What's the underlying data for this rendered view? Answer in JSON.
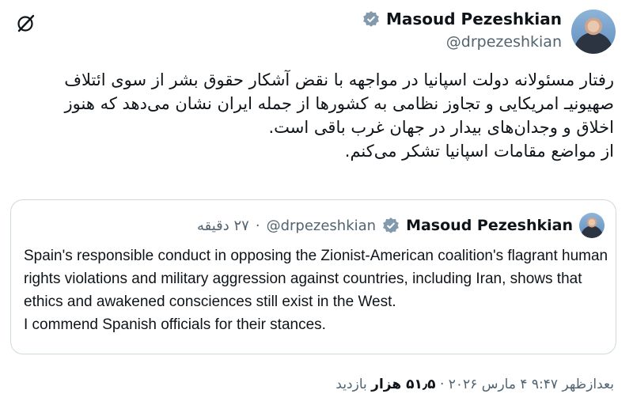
{
  "author": {
    "name": "Masoud Pezeshkian",
    "handle": "@drpezeshkian"
  },
  "tweet": {
    "lines": [
      "رفتار مسئولانه دولت اسپانیا در مواجهه با نقض آشکار حقوق بشر از سوی ائتلاف صهیونیـ امریکایی و تجاوز نظامی به کشورها از جمله ایران نشان می‌دهد که هنوز اخلاق و وجدان‌های بیدار در جهان غرب باقی است.",
      "از مواضع مقامات اسپانیا تشکر می‌کنم."
    ]
  },
  "quote": {
    "name": "Masoud Pezeshkian",
    "handle": "@drpezeshkian",
    "separator": "·",
    "time": "۲۷ دقیقه",
    "lines": [
      "Spain's responsible conduct in opposing the Zionist-American coalition's flagrant human rights violations and military aggression against countries, including Iran, shows that ethics and awakened consciences still exist in the West.",
      "I commend Spanish officials for their stances."
    ]
  },
  "meta": {
    "time": "بعدازظهر ۹:۴۷",
    "date": "۴ مارس ۲۰۲۶",
    "dot": "·",
    "views_count": "۵۱٫۵ هزار",
    "views_label": "بازدید"
  },
  "colors": {
    "text": "#0f1419",
    "secondary": "#536471",
    "border": "#cfd9de",
    "verified": "#829aab"
  },
  "icons": [
    "verified-badge-icon",
    "grok-icon"
  ]
}
